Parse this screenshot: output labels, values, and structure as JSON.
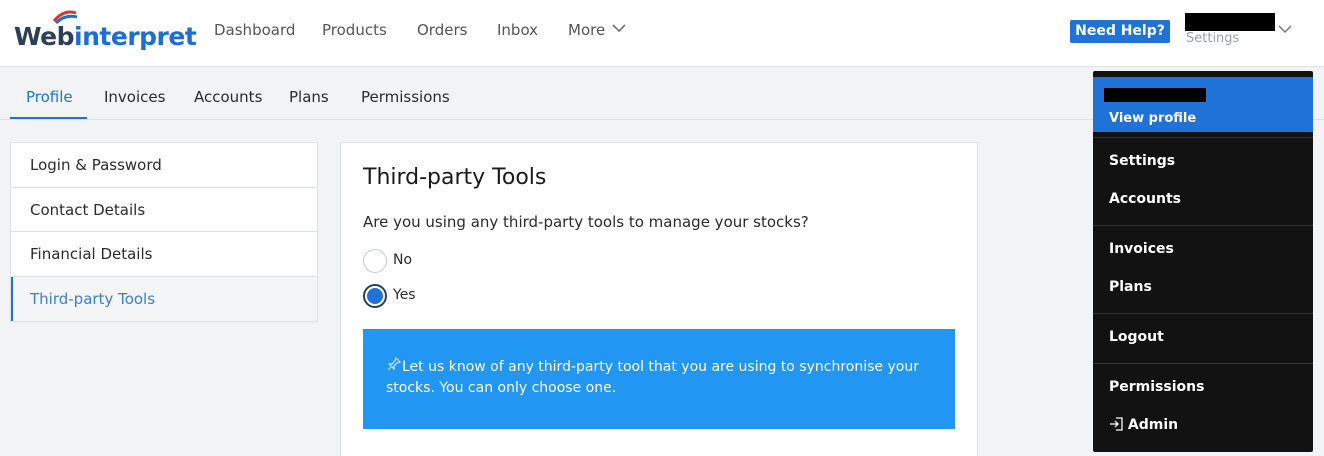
{
  "brand": {
    "part1": "Web",
    "part2": "interpret"
  },
  "nav": {
    "items": [
      "Dashboard",
      "Products",
      "Orders",
      "Inbox",
      "More"
    ]
  },
  "header": {
    "help_label": "Need Help?",
    "user_settings_label": "Settings"
  },
  "tabs": [
    "Profile",
    "Invoices",
    "Accounts",
    "Plans",
    "Permissions"
  ],
  "sidebar": {
    "items": [
      "Login & Password",
      "Contact Details",
      "Financial Details",
      "Third-party Tools"
    ]
  },
  "main": {
    "title": "Third-party Tools",
    "question": "Are you using any third-party tools to manage your stocks?",
    "options": [
      "No",
      "Yes"
    ],
    "selected": "Yes",
    "info_text": "Let us know of any third-party tool that you are using to synchronise your stocks. You can only choose one."
  },
  "dropdown": {
    "view_profile": "View profile",
    "items": [
      "Settings",
      "Accounts",
      "Invoices",
      "Plans",
      "Logout",
      "Permissions",
      "Admin"
    ]
  },
  "colors": {
    "accent": "#1f73d6",
    "info_bg": "#2196f3",
    "dropdown_bg": "#121212",
    "brand_dark": "#2a3f5a"
  }
}
